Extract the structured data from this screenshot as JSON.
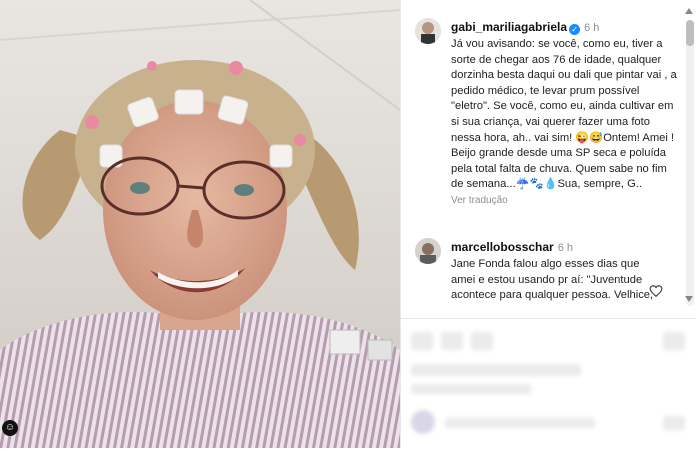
{
  "caption": {
    "username": "gabi_mariliagabriela",
    "time": "6 h",
    "text": "Já vou avisando: se você, como eu, tiver a sorte de chegar aos 76 de idade, qualquer dorzinha besta daqui ou dali que pintar vai , a pedido médico, te levar prum possível \"eletro\". Se você, como eu, ainda cultivar em si sua criança, vai querer fazer uma foto nessa hora, ah.. vai sim! 😜😅Ontem! Amei ! Beijo grande desde uma SP seca e poluída pela total falta de chuva. Quem sabe no fim de semana...☔🐾💧Sua, sempre, G..",
    "translate_label": "Ver tradução"
  },
  "comment": {
    "username": "marcellobosschar",
    "time": "6 h",
    "text": "Jane Fonda falou algo esses dias que amei e estou usando pr aí: \"Juventude acontece para qualquer pessoa. Velhice, apenas para quem..."
  },
  "icons": {
    "verified": "verified-badge-icon",
    "heart": "heart-icon",
    "corner": "instagram-corner-icon"
  },
  "colors": {
    "verified": "#1a8cff",
    "muted": "#8e8e8e"
  }
}
